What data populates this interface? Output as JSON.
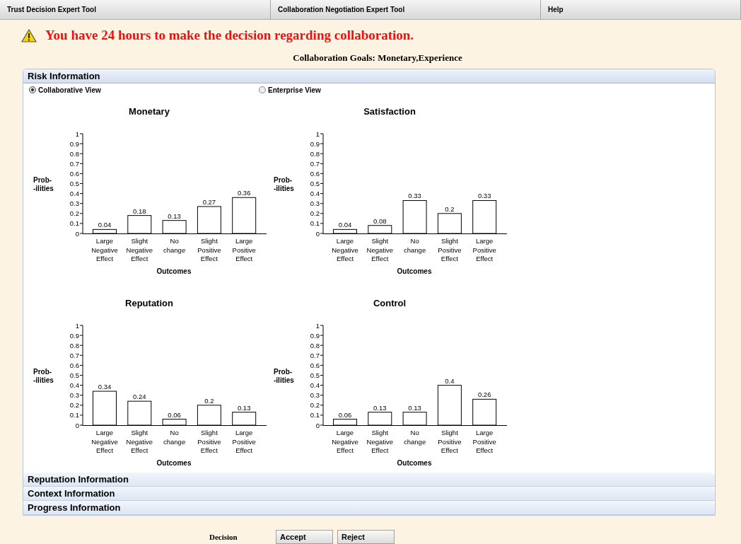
{
  "menu_bar": [
    {
      "label": "Trust Decision Expert Tool"
    },
    {
      "label": "Collaboration Negotiation Expert Tool"
    },
    {
      "label": "Help"
    }
  ],
  "warning": "You have 24 hours to make the decision regarding collaboration.",
  "goals": "Collaboration Goals: Monetary,Experience",
  "sections": [
    {
      "title": "Risk Information",
      "expanded": true
    },
    {
      "title": "Reputation Information",
      "expanded": false
    },
    {
      "title": "Context Information",
      "expanded": false
    },
    {
      "title": "Progress Information",
      "expanded": false
    }
  ],
  "view_options": [
    {
      "label": "Collaborative View",
      "selected": true
    },
    {
      "label": "Enterprise View",
      "selected": false
    }
  ],
  "charts": [
    {
      "chart_data": {
        "type": "bar",
        "title": "Monetary",
        "xlabel": "Outcomes",
        "ylabel": "Prob- -ilities",
        "categories": [
          "Large Negative Effect",
          "Slight Negative Effect",
          "No change",
          "Slight Positive Effect",
          "Large Positive Effect"
        ],
        "values": [
          0.04,
          0.18,
          0.13,
          0.27,
          0.36
        ],
        "ylim": [
          0,
          1
        ],
        "yticks": [
          0,
          0.1,
          0.2,
          0.3,
          0.4,
          0.5,
          0.6,
          0.7,
          0.8,
          0.9,
          1
        ],
        "data_labels": true
      }
    },
    {
      "chart_data": {
        "type": "bar",
        "title": "Satisfaction",
        "xlabel": "Outcomes",
        "ylabel": "Prob- -ilities",
        "categories": [
          "Large Negative Effect",
          "Slight Negative Effect",
          "No change",
          "Slight Positive Effect",
          "Large Positive Effect"
        ],
        "values": [
          0.04,
          0.08,
          0.33,
          0.2,
          0.33
        ],
        "ylim": [
          0,
          1
        ],
        "yticks": [
          0,
          0.1,
          0.2,
          0.3,
          0.4,
          0.5,
          0.6,
          0.7,
          0.8,
          0.9,
          1
        ],
        "data_labels": true
      }
    },
    {
      "chart_data": {
        "type": "bar",
        "title": "Reputation",
        "xlabel": "Outcomes",
        "ylabel": "Prob- -ilities",
        "categories": [
          "Large Negative Effect",
          "Slight Negative Effect",
          "No change",
          "Slight Positive Effect",
          "Large Positive Effect"
        ],
        "values": [
          0.34,
          0.24,
          0.06,
          0.2,
          0.13
        ],
        "ylim": [
          0,
          1
        ],
        "yticks": [
          0,
          0.1,
          0.2,
          0.3,
          0.4,
          0.5,
          0.6,
          0.7,
          0.8,
          0.9,
          1
        ],
        "data_labels": true
      }
    },
    {
      "chart_data": {
        "type": "bar",
        "title": "Control",
        "xlabel": "Outcomes",
        "ylabel": "Prob- -ilities",
        "categories": [
          "Large Negative Effect",
          "Slight Negative Effect",
          "No change",
          "Slight Positive Effect",
          "Large Positive Effect"
        ],
        "values": [
          0.06,
          0.13,
          0.13,
          0.4,
          0.26
        ],
        "ylim": [
          0,
          1
        ],
        "yticks": [
          0,
          0.1,
          0.2,
          0.3,
          0.4,
          0.5,
          0.6,
          0.7,
          0.8,
          0.9,
          1
        ],
        "data_labels": true
      }
    }
  ],
  "decision": {
    "label": "Decision",
    "buttons": [
      "Accept",
      "Reject"
    ]
  }
}
